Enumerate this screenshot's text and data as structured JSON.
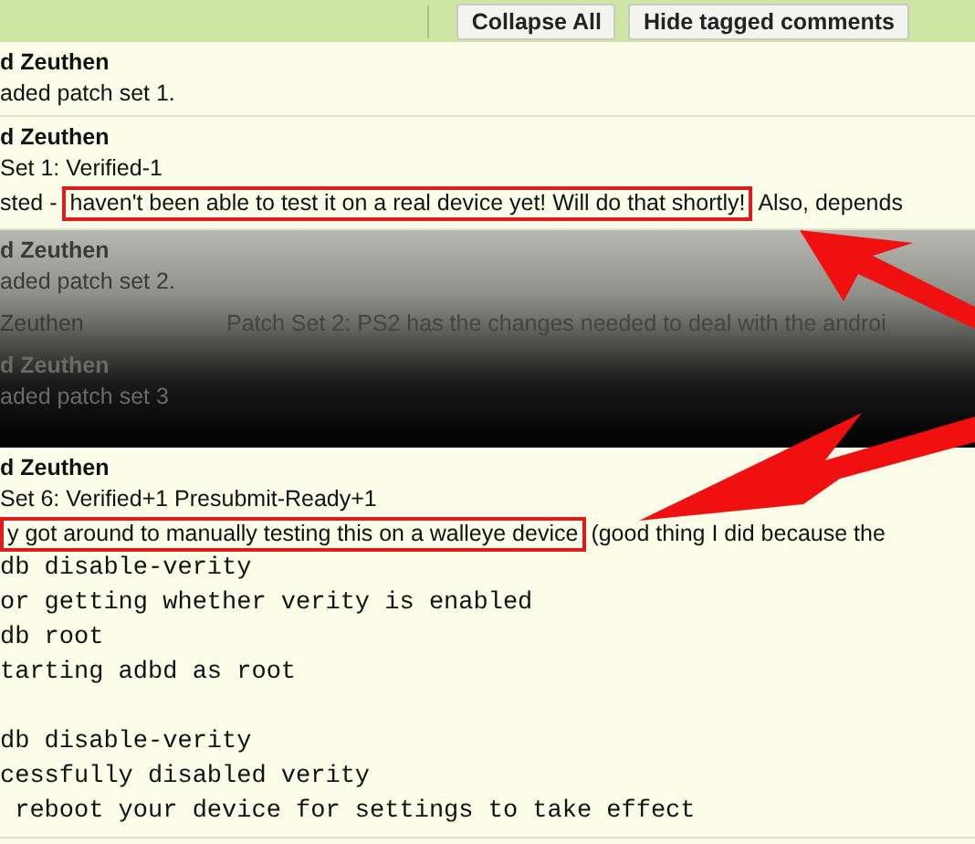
{
  "toolbar": {
    "buttons": [
      "Collapse All",
      "Hide tagged comments"
    ]
  },
  "comments": [
    {
      "kind": "expanded",
      "dimmed": false,
      "author": "d Zeuthen",
      "lines": [
        [
          {
            "text": "aded patch set 1.",
            "highlighted": false
          }
        ]
      ]
    },
    {
      "kind": "expanded",
      "dimmed": false,
      "author": "d Zeuthen",
      "lines": [
        [
          {
            "text": "Set 1: Verified-1",
            "highlighted": false
          }
        ],
        [
          {
            "text": "sted -",
            "highlighted": false
          },
          {
            "text": "haven't been able to test it on a real device yet! Will do that shortly!",
            "highlighted": true
          },
          {
            "text": "Also, depends",
            "highlighted": false
          }
        ]
      ]
    },
    {
      "kind": "expanded",
      "dimmed": true,
      "author": "d Zeuthen",
      "lines": [
        [
          {
            "text": "aded patch set 2.",
            "highlighted": false
          }
        ]
      ]
    },
    {
      "kind": "collapsed",
      "dimmed": true,
      "author": "Zeuthen",
      "summary": "Patch Set 2: PS2 has the changes needed to deal with the androi"
    },
    {
      "kind": "expanded",
      "dimmed": true,
      "author": "d Zeuthen",
      "lines": [
        [
          {
            "text": "aded patch set 3",
            "highlighted": false
          }
        ]
      ]
    },
    {
      "kind": "expanded",
      "dimmed": false,
      "author": "d Zeuthen",
      "lines": [
        [
          {
            "text": "Set 6: Verified+1 Presubmit-Ready+1",
            "highlighted": false
          }
        ],
        [
          {
            "text": "y got around to manually testing this on a walleye device",
            "highlighted": true
          },
          {
            "text": "(good thing I did because the",
            "highlighted": false
          }
        ]
      ],
      "code": [
        [
          "db disable-verity",
          "or getting whether verity is enabled",
          "db root",
          "tarting adbd as root"
        ],
        [
          "db disable-verity",
          "cessfully disabled verity",
          " reboot your device for settings to take effect"
        ]
      ]
    }
  ]
}
